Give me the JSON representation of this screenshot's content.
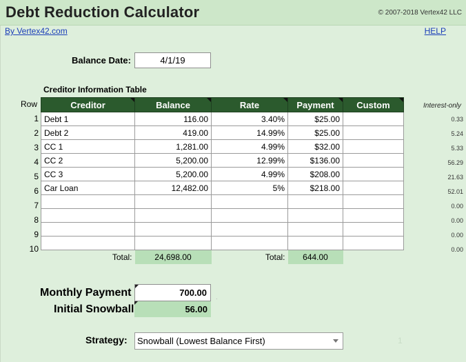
{
  "header": {
    "title": "Debt Reduction Calculator",
    "copyright": "© 2007-2018 Vertex42 LLC",
    "byline": "By Vertex42.com",
    "help": "HELP"
  },
  "balance_date": {
    "label": "Balance Date:",
    "value": "4/1/19"
  },
  "creditor_table": {
    "title": "Creditor Information Table",
    "row_header": "Row",
    "columns": [
      "Creditor",
      "Balance",
      "Rate",
      "Payment",
      "Custom"
    ],
    "rows": [
      {
        "n": "1",
        "creditor": "Debt 1",
        "balance": "116.00",
        "rate": "3.40%",
        "payment": "$25.00",
        "custom": ""
      },
      {
        "n": "2",
        "creditor": "Debt 2",
        "balance": "419.00",
        "rate": "14.99%",
        "payment": "$25.00",
        "custom": ""
      },
      {
        "n": "3",
        "creditor": "CC 1",
        "balance": "1,281.00",
        "rate": "4.99%",
        "payment": "$32.00",
        "custom": ""
      },
      {
        "n": "4",
        "creditor": "CC 2",
        "balance": "5,200.00",
        "rate": "12.99%",
        "payment": "$136.00",
        "custom": ""
      },
      {
        "n": "5",
        "creditor": "CC 3",
        "balance": "5,200.00",
        "rate": "4.99%",
        "payment": "$208.00",
        "custom": ""
      },
      {
        "n": "6",
        "creditor": "Car Loan",
        "balance": "12,482.00",
        "rate": "5%",
        "payment": "$218.00",
        "custom": ""
      },
      {
        "n": "7",
        "creditor": "",
        "balance": "",
        "rate": "",
        "payment": "",
        "custom": ""
      },
      {
        "n": "8",
        "creditor": "",
        "balance": "",
        "rate": "",
        "payment": "",
        "custom": ""
      },
      {
        "n": "9",
        "creditor": "",
        "balance": "",
        "rate": "",
        "payment": "",
        "custom": ""
      },
      {
        "n": "10",
        "creditor": "",
        "balance": "",
        "rate": "",
        "payment": "",
        "custom": ""
      }
    ],
    "total_label_balance": "Total:",
    "total_balance": "24,698.00",
    "total_label_payment": "Total:",
    "total_payment": "644.00"
  },
  "interest_only": {
    "header": "Interest-only",
    "values": [
      "0.33",
      "5.24",
      "5.33",
      "56.29",
      "21.63",
      "52.01",
      "0.00",
      "0.00",
      "0.00",
      "0.00"
    ]
  },
  "monthly_payment": {
    "label": "Monthly Payment",
    "value": "700.00"
  },
  "initial_snowball": {
    "label": "Initial Snowball",
    "value": "56.00"
  },
  "strategy": {
    "label": "Strategy:",
    "value": "Snowball (Lowest Balance First)"
  },
  "misc": {
    "ghost_digit": "1"
  },
  "colors": {
    "header_green": "#2b5a2d",
    "bg": "#deefdc",
    "total_fill": "#b8dfb8",
    "link": "#1a3db8"
  }
}
